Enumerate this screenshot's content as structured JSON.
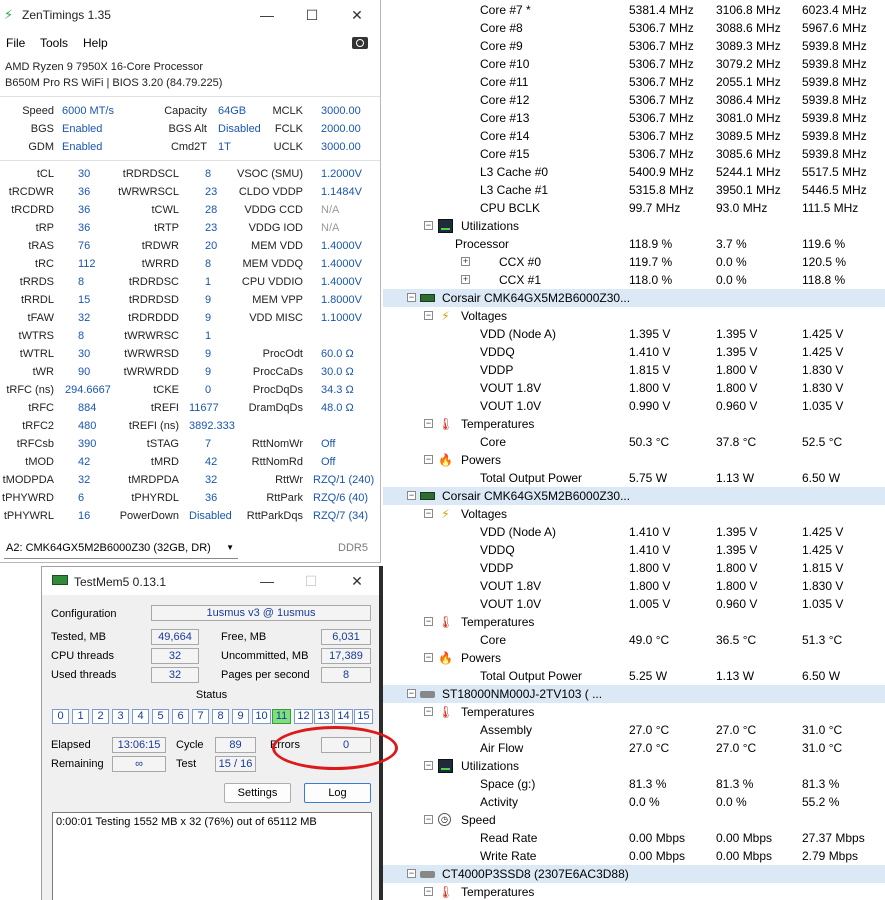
{
  "zentimings": {
    "title": "ZenTimings 1.35",
    "menu": [
      "File",
      "Tools",
      "Help"
    ],
    "cpu": "AMD Ryzen 9 7950X 16-Core Processor",
    "board": "B650M Pro RS WiFi | BIOS 3.20 (84.79.225)",
    "top": [
      [
        {
          "l": "Speed",
          "v": "6000 MT/s"
        },
        {
          "l": "Capacity",
          "v": "64GB"
        },
        {
          "l": "MCLK",
          "v": "3000.00"
        }
      ],
      [
        {
          "l": "BGS",
          "v": "Enabled"
        },
        {
          "l": "BGS Alt",
          "v": "Disabled"
        },
        {
          "l": "FCLK",
          "v": "2000.00"
        }
      ],
      [
        {
          "l": "GDM",
          "v": "Enabled"
        },
        {
          "l": "Cmd2T",
          "v": "1T"
        },
        {
          "l": "UCLK",
          "v": "3000.00"
        }
      ]
    ],
    "rows": [
      [
        {
          "l": "tCL",
          "v": "30"
        },
        {
          "l": "tRDRDSCL",
          "v": "8"
        },
        {
          "l": "VSOC (SMU)",
          "v": "1.2000V"
        }
      ],
      [
        {
          "l": "tRCDWR",
          "v": "36"
        },
        {
          "l": "tWRWRSCL",
          "v": "23"
        },
        {
          "l": "CLDO VDDP",
          "v": "1.1484V"
        }
      ],
      [
        {
          "l": "tRCDRD",
          "v": "36"
        },
        {
          "l": "tCWL",
          "v": "28"
        },
        {
          "l": "VDDG CCD",
          "v": "N/A",
          "g": true
        }
      ],
      [
        {
          "l": "tRP",
          "v": "36"
        },
        {
          "l": "tRTP",
          "v": "23"
        },
        {
          "l": "VDDG IOD",
          "v": "N/A",
          "g": true
        }
      ],
      [
        {
          "l": "tRAS",
          "v": "76"
        },
        {
          "l": "tRDWR",
          "v": "20"
        },
        {
          "l": "MEM VDD",
          "v": "1.4000V"
        }
      ],
      [
        {
          "l": "tRC",
          "v": "112"
        },
        {
          "l": "tWRRD",
          "v": "8"
        },
        {
          "l": "MEM VDDQ",
          "v": "1.4000V"
        }
      ],
      [
        {
          "l": "tRRDS",
          "v": "8"
        },
        {
          "l": "tRDRDSC",
          "v": "1"
        },
        {
          "l": "CPU VDDIO",
          "v": "1.4000V"
        }
      ],
      [
        {
          "l": "tRRDL",
          "v": "15"
        },
        {
          "l": "tRDRDSD",
          "v": "9"
        },
        {
          "l": "MEM VPP",
          "v": "1.8000V"
        }
      ],
      [
        {
          "l": "tFAW",
          "v": "32"
        },
        {
          "l": "tRDRDDD",
          "v": "9"
        },
        {
          "l": "VDD MISC",
          "v": "1.1000V"
        }
      ],
      [
        {
          "l": "tWTRS",
          "v": "8"
        },
        {
          "l": "tWRWRSC",
          "v": "1"
        },
        {
          "l": "",
          "v": ""
        }
      ],
      [
        {
          "l": "tWTRL",
          "v": "30"
        },
        {
          "l": "tWRWRSD",
          "v": "9"
        },
        {
          "l": "ProcOdt",
          "v": "60.0 Ω"
        }
      ],
      [
        {
          "l": "tWR",
          "v": "90"
        },
        {
          "l": "tWRWRDD",
          "v": "9"
        },
        {
          "l": "ProcCaDs",
          "v": "30.0 Ω"
        }
      ],
      [
        {
          "l": "tRFC (ns)",
          "v": "294.6667"
        },
        {
          "l": "tCKE",
          "v": "0"
        },
        {
          "l": "ProcDqDs",
          "v": "34.3 Ω"
        }
      ],
      [
        {
          "l": "tRFC",
          "v": "884"
        },
        {
          "l": "tREFI",
          "v": "11677"
        },
        {
          "l": "DramDqDs",
          "v": "48.0 Ω"
        }
      ],
      [
        {
          "l": "tRFC2",
          "v": "480"
        },
        {
          "l": "tREFI (ns)",
          "v": "3892.333"
        },
        {
          "l": "",
          "v": ""
        }
      ],
      [
        {
          "l": "tRFCsb",
          "v": "390"
        },
        {
          "l": "tSTAG",
          "v": "7"
        },
        {
          "l": "RttNomWr",
          "v": "Off"
        }
      ],
      [
        {
          "l": "tMOD",
          "v": "42"
        },
        {
          "l": "tMRD",
          "v": "42"
        },
        {
          "l": "RttNomRd",
          "v": "Off"
        }
      ],
      [
        {
          "l": "tMODPDA",
          "v": "32"
        },
        {
          "l": "tMRDPDA",
          "v": "32"
        },
        {
          "l": "RttWr",
          "v": "RZQ/1 (240)"
        }
      ],
      [
        {
          "l": "tPHYWRD",
          "v": "6"
        },
        {
          "l": "tPHYRDL",
          "v": "36"
        },
        {
          "l": "RttPark",
          "v": "RZQ/6 (40)"
        }
      ],
      [
        {
          "l": "tPHYWRL",
          "v": "16"
        },
        {
          "l": "PowerDown",
          "v": "Disabled"
        },
        {
          "l": "RttParkDqs",
          "v": "RZQ/7 (34)"
        }
      ]
    ],
    "module": "A2: CMK64GX5M2B6000Z30 (32GB, DR)",
    "ddr": "DDR5"
  },
  "testmem": {
    "title": "TestMem5   0.13.1",
    "config_label": "Configuration",
    "config_value": "1usmus v3 @ 1usmus",
    "tested_label": "Tested, MB",
    "tested": "49,664",
    "free_label": "Free, MB",
    "free": "6,031",
    "cpu_label": "CPU threads",
    "cpu": "32",
    "uncommitted_label": "Uncommitted, MB",
    "uncommitted": "17,389",
    "used_label": "Used threads",
    "used": "32",
    "pps_label": "Pages per second",
    "pps": "8",
    "status_label": "Status",
    "cells": [
      "0",
      "1",
      "2",
      "3",
      "4",
      "5",
      "6",
      "7",
      "8",
      "9",
      "10",
      "11",
      "12",
      "13",
      "14",
      "15"
    ],
    "active_cell": 11,
    "elapsed_label": "Elapsed",
    "elapsed": "13:06:15",
    "cycle_label": "Cycle",
    "cycle": "89",
    "errors_label": "Errors",
    "errors": "0",
    "remaining_label": "Remaining",
    "remaining": "∞",
    "test_label": "Test",
    "test": "15 / 16",
    "settings_btn": "Settings",
    "log_btn": "Log",
    "log": "0:00:01  Testing 1552 MB x 32 (76%) out of 65112 MB"
  },
  "hwinfo": [
    {
      "lv": 3,
      "t": "Core #7 *",
      "v": [
        "5381.4 MHz",
        "3106.8 MHz",
        "6023.4 MHz"
      ]
    },
    {
      "lv": 3,
      "t": "Core #8",
      "v": [
        "5306.7 MHz",
        "3088.6 MHz",
        "5967.6 MHz"
      ]
    },
    {
      "lv": 3,
      "t": "Core #9",
      "v": [
        "5306.7 MHz",
        "3089.3 MHz",
        "5939.8 MHz"
      ]
    },
    {
      "lv": 3,
      "t": "Core #10",
      "v": [
        "5306.7 MHz",
        "3079.2 MHz",
        "5939.8 MHz"
      ]
    },
    {
      "lv": 3,
      "t": "Core #11",
      "v": [
        "5306.7 MHz",
        "2055.1 MHz",
        "5939.8 MHz"
      ]
    },
    {
      "lv": 3,
      "t": "Core #12",
      "v": [
        "5306.7 MHz",
        "3086.4 MHz",
        "5939.8 MHz"
      ]
    },
    {
      "lv": 3,
      "t": "Core #13",
      "v": [
        "5306.7 MHz",
        "3081.0 MHz",
        "5939.8 MHz"
      ]
    },
    {
      "lv": 3,
      "t": "Core #14",
      "v": [
        "5306.7 MHz",
        "3089.5 MHz",
        "5939.8 MHz"
      ]
    },
    {
      "lv": 3,
      "t": "Core #15",
      "v": [
        "5306.7 MHz",
        "3085.6 MHz",
        "5939.8 MHz"
      ]
    },
    {
      "lv": 3,
      "t": "L3 Cache #0",
      "v": [
        "5400.9 MHz",
        "5244.1 MHz",
        "5517.5 MHz"
      ]
    },
    {
      "lv": 3,
      "t": "L3 Cache #1",
      "v": [
        "5315.8 MHz",
        "3950.1 MHz",
        "5446.5 MHz"
      ]
    },
    {
      "lv": 3,
      "t": "CPU BCLK",
      "v": [
        "99.7 MHz",
        "93.0 MHz",
        "111.5 MHz"
      ]
    },
    {
      "lv": 1,
      "t": "Utilizations",
      "icon": "util",
      "exp": "−"
    },
    {
      "lv": 2,
      "t": "Processor",
      "v": [
        "118.9 %",
        "3.7 %",
        "119.6 %"
      ]
    },
    {
      "lv": 4,
      "t": "CCX #0",
      "exp": "+",
      "v": [
        "119.7 %",
        "0.0 %",
        "120.5 %"
      ]
    },
    {
      "lv": 4,
      "t": "CCX #1",
      "exp": "+",
      "v": [
        "118.0 %",
        "0.0 %",
        "118.8 %"
      ]
    },
    {
      "lv": 0,
      "t": "Corsair CMK64GX5M2B6000Z30...",
      "icon": "mem",
      "exp": "−",
      "dev": true
    },
    {
      "lv": 1,
      "t": "Voltages",
      "icon": "volt",
      "exp": "−"
    },
    {
      "lv": 3,
      "t": "VDD (Node A)",
      "v": [
        "1.395 V",
        "1.395 V",
        "1.425 V"
      ]
    },
    {
      "lv": 3,
      "t": "VDDQ",
      "v": [
        "1.410 V",
        "1.395 V",
        "1.425 V"
      ]
    },
    {
      "lv": 3,
      "t": "VDDP",
      "v": [
        "1.815 V",
        "1.800 V",
        "1.830 V"
      ]
    },
    {
      "lv": 3,
      "t": "VOUT 1.8V",
      "v": [
        "1.800 V",
        "1.800 V",
        "1.830 V"
      ]
    },
    {
      "lv": 3,
      "t": "VOUT 1.0V",
      "v": [
        "0.990 V",
        "0.960 V",
        "1.035 V"
      ]
    },
    {
      "lv": 1,
      "t": "Temperatures",
      "icon": "temp",
      "exp": "−"
    },
    {
      "lv": 3,
      "t": "Core",
      "v": [
        "50.3 °C",
        "37.8 °C",
        "52.5 °C"
      ]
    },
    {
      "lv": 1,
      "t": "Powers",
      "icon": "pow",
      "exp": "−"
    },
    {
      "lv": 3,
      "t": "Total Output Power",
      "v": [
        "5.75 W",
        "1.13 W",
        "6.50 W"
      ]
    },
    {
      "lv": 0,
      "t": "Corsair CMK64GX5M2B6000Z30...",
      "icon": "mem",
      "exp": "−",
      "dev": true
    },
    {
      "lv": 1,
      "t": "Voltages",
      "icon": "volt",
      "exp": "−"
    },
    {
      "lv": 3,
      "t": "VDD (Node A)",
      "v": [
        "1.410 V",
        "1.395 V",
        "1.425 V"
      ]
    },
    {
      "lv": 3,
      "t": "VDDQ",
      "v": [
        "1.410 V",
        "1.395 V",
        "1.425 V"
      ]
    },
    {
      "lv": 3,
      "t": "VDDP",
      "v": [
        "1.800 V",
        "1.800 V",
        "1.815 V"
      ]
    },
    {
      "lv": 3,
      "t": "VOUT 1.8V",
      "v": [
        "1.800 V",
        "1.800 V",
        "1.830 V"
      ]
    },
    {
      "lv": 3,
      "t": "VOUT 1.0V",
      "v": [
        "1.005 V",
        "0.960 V",
        "1.035 V"
      ]
    },
    {
      "lv": 1,
      "t": "Temperatures",
      "icon": "temp",
      "exp": "−"
    },
    {
      "lv": 3,
      "t": "Core",
      "v": [
        "49.0 °C",
        "36.5 °C",
        "51.3 °C"
      ]
    },
    {
      "lv": 1,
      "t": "Powers",
      "icon": "pow",
      "exp": "−"
    },
    {
      "lv": 3,
      "t": "Total Output Power",
      "v": [
        "5.25 W",
        "1.13 W",
        "6.50 W"
      ]
    },
    {
      "lv": 0,
      "t": "ST18000NM000J-2TV103 (        ...",
      "icon": "disk",
      "exp": "−",
      "dev": true
    },
    {
      "lv": 1,
      "t": "Temperatures",
      "icon": "temp",
      "exp": "−"
    },
    {
      "lv": 3,
      "t": "Assembly",
      "v": [
        "27.0 °C",
        "27.0 °C",
        "31.0 °C"
      ]
    },
    {
      "lv": 3,
      "t": "Air Flow",
      "v": [
        "27.0 °C",
        "27.0 °C",
        "31.0 °C"
      ]
    },
    {
      "lv": 1,
      "t": "Utilizations",
      "icon": "util",
      "exp": "−"
    },
    {
      "lv": 3,
      "t": "Space (g:)",
      "v": [
        "81.3 %",
        "81.3 %",
        "81.3 %"
      ]
    },
    {
      "lv": 3,
      "t": "Activity",
      "v": [
        "0.0 %",
        "0.0 %",
        "55.2 %"
      ]
    },
    {
      "lv": 1,
      "t": "Speed",
      "icon": "speed",
      "exp": "−"
    },
    {
      "lv": 3,
      "t": "Read Rate",
      "v": [
        "0.00 Mbps",
        "0.00 Mbps",
        "27.37 Mbps"
      ]
    },
    {
      "lv": 3,
      "t": "Write Rate",
      "v": [
        "0.00 Mbps",
        "0.00 Mbps",
        "2.79 Mbps"
      ]
    },
    {
      "lv": 0,
      "t": "CT4000P3SSD8 (2307E6AC3D88)",
      "icon": "disk",
      "exp": "−",
      "dev": true
    },
    {
      "lv": 1,
      "t": "Temperatures",
      "icon": "temp",
      "exp": "−"
    }
  ]
}
